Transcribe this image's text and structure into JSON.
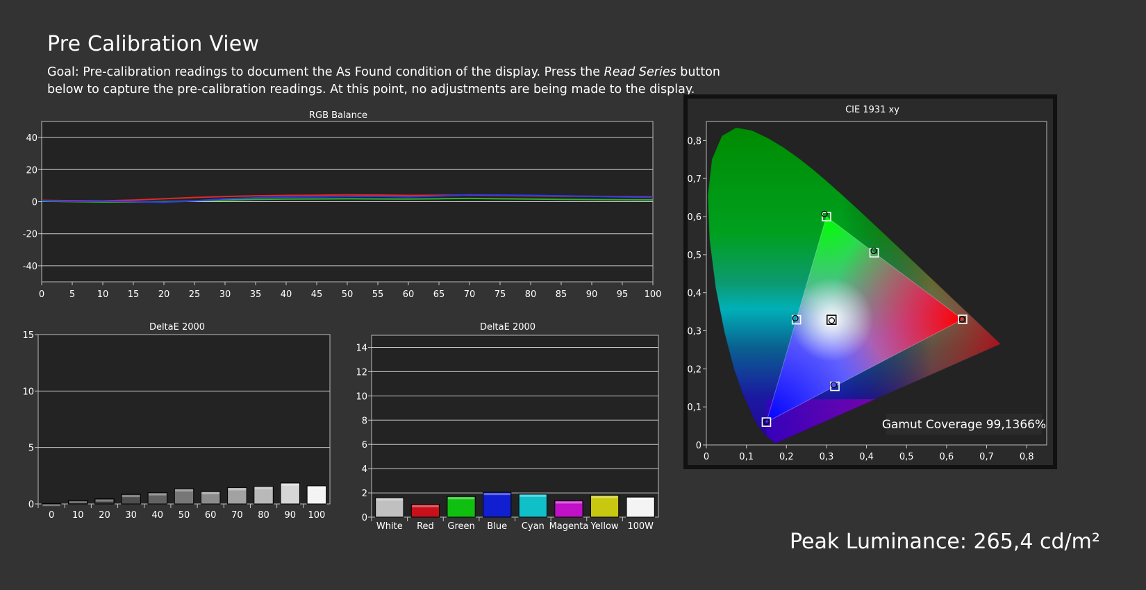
{
  "page": {
    "title": "Pre Calibration View",
    "goal_prefix": "Goal: Pre-calibration readings to document the As Found condition of the display. Press the ",
    "goal_emphasis": "Read Series",
    "goal_suffix": " button below to capture the pre-calibration readings. At this point, no adjustments are being made to the display.",
    "peak_luminance": "Peak Luminance: 265,4 cd/m²"
  },
  "colors": {
    "background": "#333333",
    "plot_background": "#232323",
    "grid": "#c8c8c8",
    "red_line": "#e0282c",
    "green_line": "#2fb02f",
    "blue_line": "#2a3ce8"
  },
  "chart_data": [
    {
      "id": "rgb-balance",
      "type": "line",
      "title": "RGB Balance",
      "xlabel": "",
      "ylabel": "",
      "x": [
        0,
        5,
        10,
        15,
        20,
        25,
        30,
        35,
        40,
        45,
        50,
        55,
        60,
        65,
        70,
        75,
        80,
        85,
        90,
        95,
        100
      ],
      "xlim": [
        0,
        100
      ],
      "ylim": [
        -50,
        50
      ],
      "xticks": [
        "0",
        "5",
        "10",
        "15",
        "20",
        "25",
        "30",
        "35",
        "40",
        "45",
        "50",
        "55",
        "60",
        "65",
        "70",
        "75",
        "80",
        "85",
        "90",
        "95",
        "100"
      ],
      "yticks": [
        -40,
        -20,
        0,
        20,
        40
      ],
      "ytick_labels": [
        "-40",
        "-20",
        "0",
        "20",
        "40"
      ],
      "grid": true,
      "series": [
        {
          "color": "#e0282c",
          "values": [
            0.8,
            0.6,
            0.5,
            1.0,
            1.8,
            2.6,
            3.2,
            3.6,
            3.9,
            4.0,
            4.2,
            4.1,
            3.9,
            4.0,
            4.1,
            3.9,
            3.6,
            3.4,
            3.3,
            3.2,
            3.0
          ]
        },
        {
          "color": "#2fb02f",
          "values": [
            0.3,
            0.0,
            -0.2,
            -0.2,
            0.0,
            0.5,
            1.0,
            1.4,
            1.6,
            1.7,
            1.8,
            1.7,
            1.6,
            1.8,
            2.0,
            1.8,
            1.6,
            1.4,
            1.3,
            1.2,
            1.1
          ]
        },
        {
          "color": "#2a3ce8",
          "values": [
            0.6,
            0.2,
            0.3,
            0.0,
            -0.4,
            0.5,
            1.8,
            2.4,
            2.8,
            2.9,
            3.2,
            3.3,
            3.0,
            3.5,
            4.3,
            4.1,
            3.9,
            3.6,
            3.3,
            3.0,
            2.6
          ]
        }
      ]
    },
    {
      "id": "deltae-grayscale",
      "type": "bar",
      "title": "DeltaE 2000",
      "xlabel": "",
      "ylabel": "",
      "categories": [
        "0",
        "10",
        "20",
        "30",
        "40",
        "50",
        "60",
        "70",
        "80",
        "90",
        "100"
      ],
      "values": [
        0.05,
        0.3,
        0.45,
        0.85,
        1.0,
        1.35,
        1.1,
        1.45,
        1.55,
        1.85,
        1.6
      ],
      "bar_colors": [
        "#1a1a1a",
        "#2a2a2a",
        "#3c3c3c",
        "#4e4e4e",
        "#626262",
        "#777777",
        "#8c8c8c",
        "#a2a2a2",
        "#b9b9b9",
        "#d6d6d6",
        "#f4f4f4"
      ],
      "ylim": [
        0,
        15
      ],
      "yticks": [
        0,
        5,
        10,
        15
      ],
      "ytick_labels": [
        "0",
        "5",
        "10",
        "15"
      ],
      "grid": true
    },
    {
      "id": "deltae-colors",
      "type": "bar",
      "title": "DeltaE 2000",
      "xlabel": "",
      "ylabel": "",
      "categories": [
        "White",
        "Red",
        "Green",
        "Blue",
        "Cyan",
        "Magenta",
        "Yellow",
        "100W"
      ],
      "values": [
        1.6,
        1.05,
        1.7,
        2.05,
        1.9,
        1.35,
        1.8,
        1.65
      ],
      "bar_colors": [
        "#c0c0c0",
        "#c8101a",
        "#10c010",
        "#1020d0",
        "#10c0c8",
        "#c010c8",
        "#c8c810",
        "#f4f4f4"
      ],
      "ylim": [
        0,
        15
      ],
      "yticks": [
        0,
        2,
        4,
        6,
        8,
        10,
        12,
        14
      ],
      "ytick_labels": [
        "0",
        "2",
        "4",
        "6",
        "8",
        "10",
        "12",
        "14"
      ],
      "grid": true
    },
    {
      "id": "cie-1931",
      "type": "scatter",
      "title": "CIE 1931 xy",
      "xlabel": "",
      "ylabel": "",
      "xlim": [
        0,
        0.85
      ],
      "ylim": [
        0,
        0.85
      ],
      "xticks": [
        0,
        0.1,
        0.2,
        0.3,
        0.4,
        0.5,
        0.6,
        0.7,
        0.8
      ],
      "xtick_labels": [
        "0",
        "0,1",
        "0,2",
        "0,3",
        "0,4",
        "0,5",
        "0,6",
        "0,7",
        "0,8"
      ],
      "yticks": [
        0,
        0.1,
        0.2,
        0.3,
        0.4,
        0.5,
        0.6,
        0.7,
        0.8
      ],
      "ytick_labels": [
        "0",
        "0,1",
        "0,2",
        "0,3",
        "0,4",
        "0,5",
        "0,6",
        "0,7",
        "0,8"
      ],
      "grid": false,
      "gamut_triangle": [
        [
          0.64,
          0.33
        ],
        [
          0.3,
          0.6
        ],
        [
          0.15,
          0.06
        ]
      ],
      "targets": [
        {
          "name": "Red",
          "x": 0.64,
          "y": 0.33
        },
        {
          "name": "Green",
          "x": 0.3,
          "y": 0.6
        },
        {
          "name": "Blue",
          "x": 0.15,
          "y": 0.06
        },
        {
          "name": "Cyan",
          "x": 0.225,
          "y": 0.329
        },
        {
          "name": "Magenta",
          "x": 0.321,
          "y": 0.154
        },
        {
          "name": "Yellow",
          "x": 0.419,
          "y": 0.505
        },
        {
          "name": "White",
          "x": 0.3127,
          "y": 0.329
        }
      ],
      "measured": [
        {
          "name": "Red",
          "x": 0.639,
          "y": 0.33
        },
        {
          "name": "Green",
          "x": 0.295,
          "y": 0.607
        },
        {
          "name": "Blue",
          "x": 0.15,
          "y": 0.061
        },
        {
          "name": "Cyan",
          "x": 0.222,
          "y": 0.333
        },
        {
          "name": "Magenta",
          "x": 0.318,
          "y": 0.158
        },
        {
          "name": "Yellow",
          "x": 0.418,
          "y": 0.51
        },
        {
          "name": "White",
          "x": 0.313,
          "y": 0.327
        }
      ],
      "annotation": "Gamut Coverage 99,1366%"
    }
  ]
}
